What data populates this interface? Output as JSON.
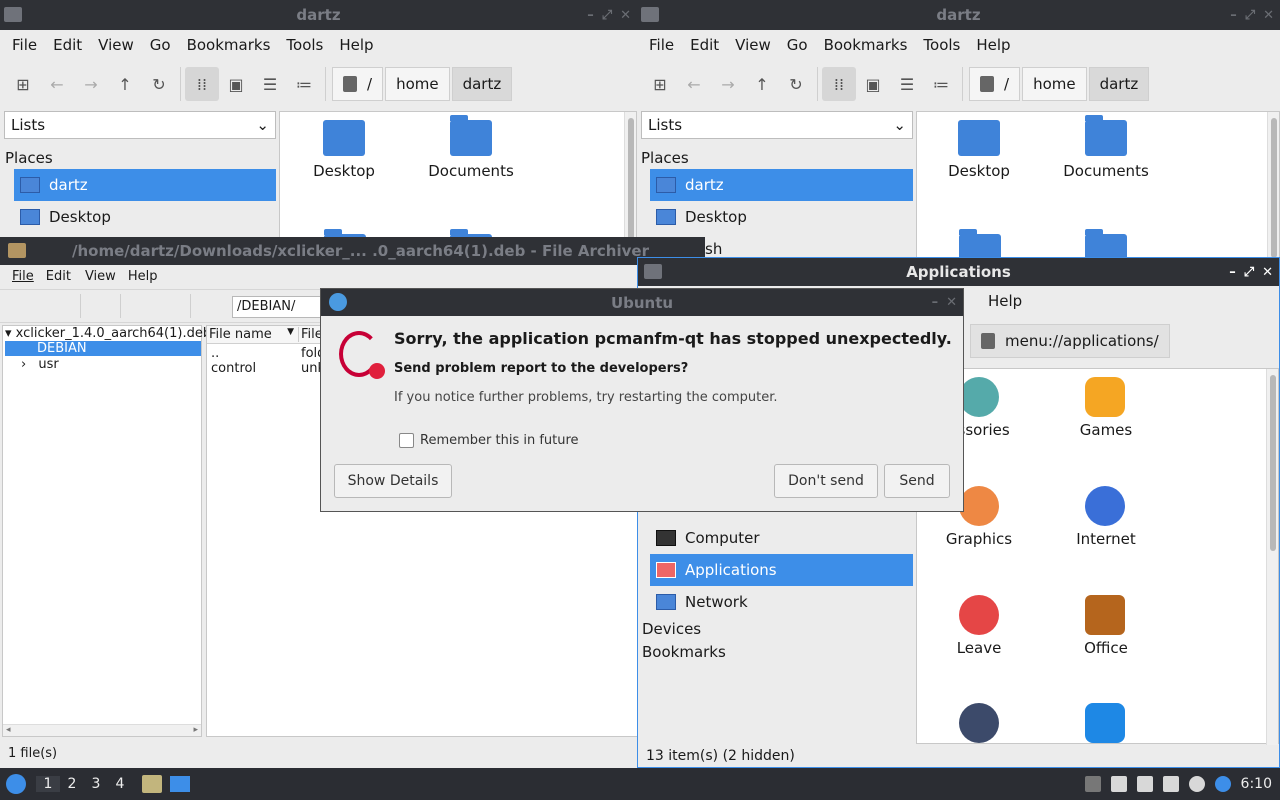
{
  "left_fm": {
    "title": "dartz",
    "menu": [
      "File",
      "Edit",
      "View",
      "Go",
      "Bookmarks",
      "Tools",
      "Help"
    ],
    "path": [
      "/",
      "home",
      "dartz"
    ],
    "side_combo": "Lists",
    "places_label": "Places",
    "places": [
      "dartz",
      "Desktop"
    ],
    "icons": [
      "Desktop",
      "Documents"
    ]
  },
  "right_fm": {
    "title": "dartz",
    "menu": [
      "File",
      "Edit",
      "View",
      "Go",
      "Bookmarks",
      "Tools",
      "Help"
    ],
    "path": [
      "/",
      "home",
      "dartz"
    ],
    "side_combo": "Lists",
    "places_label": "Places",
    "places": [
      "dartz",
      "Desktop",
      "sh"
    ],
    "icons": [
      "Desktop",
      "Documents"
    ]
  },
  "archiver": {
    "title": "/home/dartz/Downloads/xclicker_... .0_aarch64(1).deb - File Archiver",
    "menu": [
      "File",
      "Edit",
      "View",
      "Help"
    ],
    "location": "/DEBIAN/",
    "tree": [
      "xclicker_1.4.0_aarch64(1).deb",
      "DEBIAN",
      "usr"
    ],
    "columns": [
      "File name",
      "File"
    ],
    "rows": [
      {
        "name": "..",
        "type": "fold"
      },
      {
        "name": "control",
        "type": "unk"
      }
    ],
    "status": "1 file(s)"
  },
  "apps_window": {
    "title": "Applications",
    "menu_visible": "Help",
    "menu_partial": "s",
    "location": "menu://applications/",
    "sidebar": [
      "Computer",
      "Applications",
      "Network"
    ],
    "sections": [
      "Devices",
      "Bookmarks"
    ],
    "apps": [
      "essories",
      "Games",
      "Graphics",
      "Internet",
      "Leave",
      "Office"
    ],
    "status": "13 item(s) (2 hidden)"
  },
  "dialog": {
    "title": "Ubuntu",
    "heading": "Sorry, the application pcmanfm-qt has stopped unexpectedly.",
    "question": "Send problem report to the developers?",
    "hint": "If you notice further problems, try restarting the computer.",
    "checkbox": "Remember this in future",
    "show_details": "Show Details",
    "dont_send": "Don't send",
    "send": "Send"
  },
  "taskbar": {
    "desktops": [
      "1",
      "2",
      "3",
      "4"
    ],
    "clock": "6:10"
  },
  "colors": {
    "accent": "#3d8ee8",
    "titlebar": "#2f3136",
    "folder": "#3f83d9"
  }
}
